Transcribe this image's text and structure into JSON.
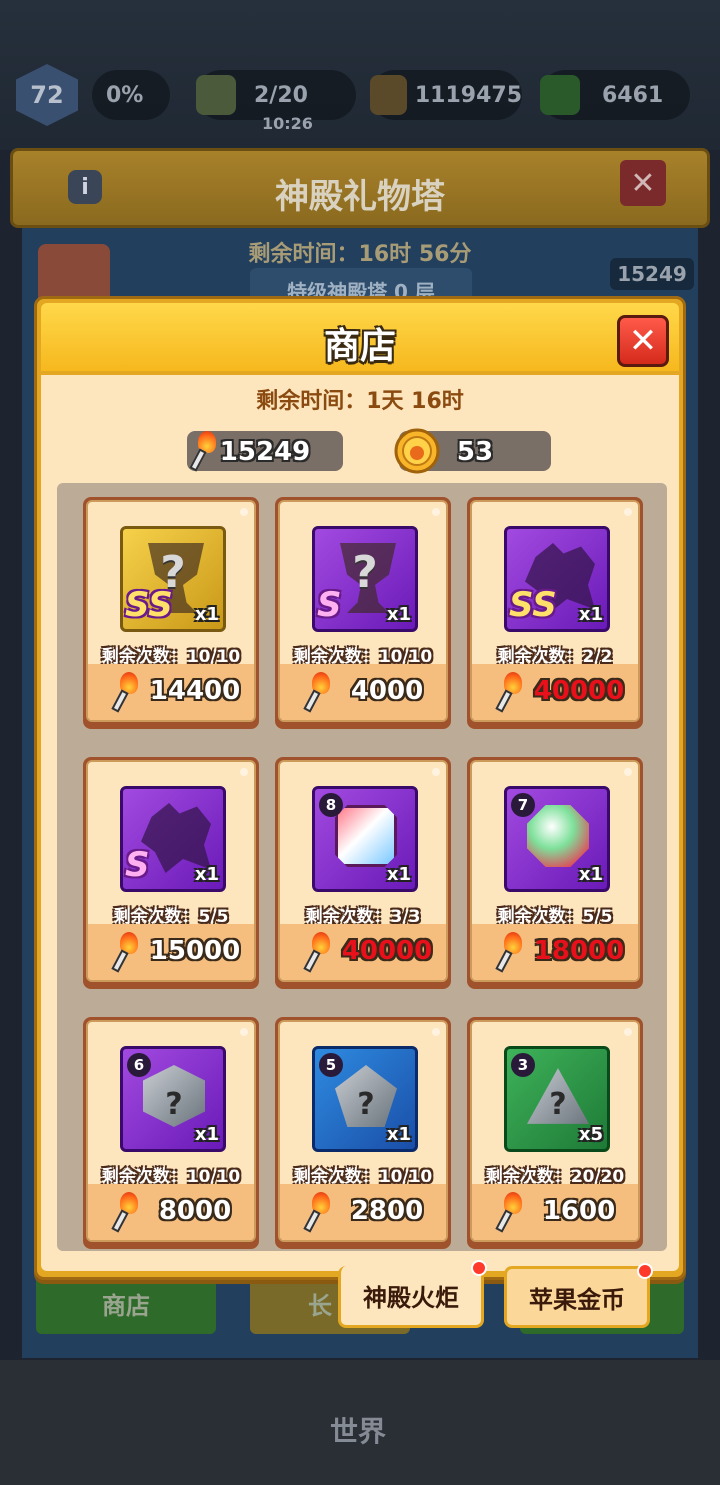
{
  "background": {
    "level": "72",
    "percent": "0%",
    "stamina": "2/20",
    "stamina_timer": "10:26",
    "gold": "1119475",
    "gems": "6461",
    "header_title": "神殿礼物塔",
    "remaining_time": "剩余时间：16时 56分",
    "torch_count": "15249",
    "subtitle": "特级神殿塔 0 层",
    "bottom_left_button": "商店",
    "bottom_middle_button": "长",
    "nav_world": "世界"
  },
  "shop": {
    "title": "商店",
    "close_label": "✕",
    "remaining_time": "剩余时间：1天 16时",
    "currencies": [
      {
        "icon": "torch-icon",
        "value": "15249"
      },
      {
        "icon": "apple-coin-icon",
        "value": "53"
      }
    ],
    "items": [
      {
        "thumb": "gold",
        "art": "trophy",
        "grade": "SS",
        "level": "",
        "qty": "x1",
        "remaining": "剩余次数：10/10",
        "price": "14400",
        "affordable": true
      },
      {
        "thumb": "purple",
        "art": "trophy",
        "grade": "S",
        "level": "",
        "qty": "x1",
        "remaining": "剩余次数：10/10",
        "price": "4000",
        "affordable": true
      },
      {
        "thumb": "purple",
        "art": "dragon",
        "grade": "SS",
        "level": "",
        "qty": "x1",
        "remaining": "剩余次数：2/2",
        "price": "40000",
        "affordable": false
      },
      {
        "thumb": "purple",
        "art": "dragon",
        "grade": "S",
        "level": "",
        "qty": "x1",
        "remaining": "剩余次数：5/5",
        "price": "15000",
        "affordable": true
      },
      {
        "thumb": "purple",
        "art": "rainbow",
        "grade": "",
        "level": "8",
        "qty": "x1",
        "remaining": "剩余次数：3/3",
        "price": "40000",
        "affordable": false
      },
      {
        "thumb": "purple",
        "art": "greenstone",
        "grade": "",
        "level": "7",
        "qty": "x1",
        "remaining": "剩余次数：5/5",
        "price": "18000",
        "affordable": false
      },
      {
        "thumb": "purple",
        "art": "hexstone",
        "grade": "",
        "level": "6",
        "qty": "x1",
        "remaining": "剩余次数：10/10",
        "price": "8000",
        "affordable": true
      },
      {
        "thumb": "blue",
        "art": "pentstone",
        "grade": "",
        "level": "5",
        "qty": "x1",
        "remaining": "剩余次数：10/10",
        "price": "2800",
        "affordable": true
      },
      {
        "thumb": "green",
        "art": "tristone",
        "grade": "",
        "level": "3",
        "qty": "x5",
        "remaining": "剩余次数：20/20",
        "price": "1600",
        "affordable": true
      }
    ],
    "tabs": [
      {
        "label": "神殿火炬",
        "active": true,
        "has_dot": true
      },
      {
        "label": "苹果金币",
        "active": false,
        "has_dot": true
      }
    ]
  },
  "colors": {
    "modal_frame": "#e3a722",
    "content_bg": "#fde6be",
    "price_short": "#e8101a"
  }
}
